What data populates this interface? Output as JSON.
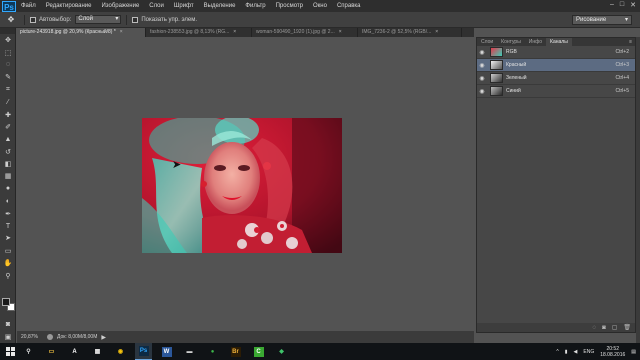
{
  "app": {
    "logo": "Ps"
  },
  "menu": [
    "Файл",
    "Редактирование",
    "Изображение",
    "Слои",
    "Шрифт",
    "Выделение",
    "Фильтр",
    "Просмотр",
    "Окно",
    "Справка"
  ],
  "window_controls": {
    "minimize": "–",
    "maximize": "□",
    "close": "✕"
  },
  "options": {
    "autoselect_label": "Автовыбор:",
    "autoselect_value": "Слой",
    "show_controls_label": "Показать упр. элем.",
    "workspace": "Рисование"
  },
  "tabs": [
    {
      "label": "picture-243918.jpg @ 20,9% (Красный/8) *",
      "active": true
    },
    {
      "label": "fashion-238553.jpg @ 8,13% (RG...",
      "active": false
    },
    {
      "label": "woman-590490_1920 (1).jpg @ 2...",
      "active": false
    },
    {
      "label": "IMG_7236-2 @ 52,5% (RGB/...",
      "active": false
    }
  ],
  "status": {
    "zoom": "20,87%",
    "doc": "Док: 8,00М/8,00М"
  },
  "channels_panel": {
    "tabs": [
      "Слои",
      "Контуры",
      "Инфо",
      "Каналы"
    ],
    "active_tab": "Каналы",
    "channels": [
      {
        "name": "RGB",
        "shortcut": "Ctrl+2",
        "selected": false
      },
      {
        "name": "Красный",
        "shortcut": "Ctrl+3",
        "selected": true
      },
      {
        "name": "Зеленый",
        "shortcut": "Ctrl+4",
        "selected": false
      },
      {
        "name": "Синий",
        "shortcut": "Ctrl+5",
        "selected": false
      }
    ]
  },
  "taskbar": {
    "apps": [
      "search-icon",
      "file-explorer-icon",
      "store-icon",
      "calculator-icon",
      "chrome-icon",
      "photoshop-icon",
      "word-icon",
      "files-icon",
      "green-app-icon",
      "bridge-icon",
      "lime-app-icon",
      "camtasia-icon"
    ],
    "language": "ENG",
    "time": "20:52",
    "date": "18.08.2016"
  },
  "colors": {
    "accent": "#31a8ff",
    "selection": "#5c6b82"
  }
}
